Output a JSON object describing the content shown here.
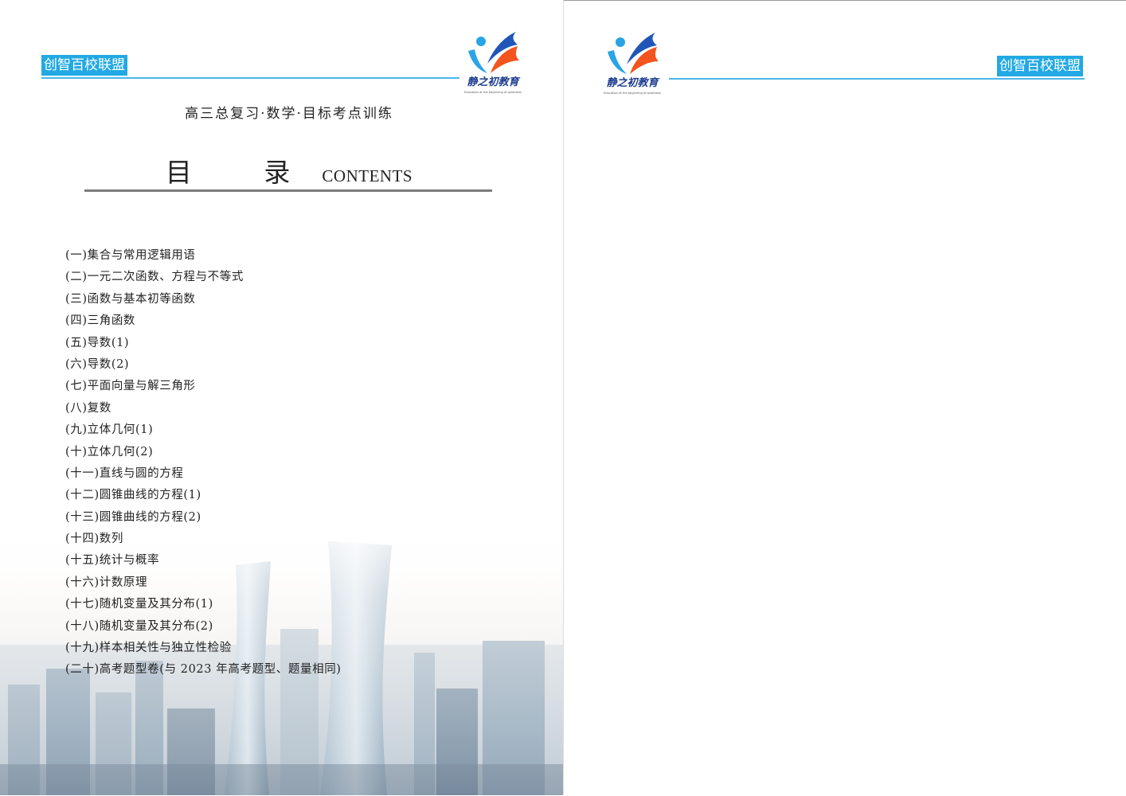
{
  "header": {
    "brand_left": "创智百校联盟",
    "brand_right": "创智百校联盟",
    "logo_text": "静之初教育",
    "logo_tagline": "Education at the beginning of quietness",
    "brand_color": "#22a9e3",
    "logo_colors": [
      "#1f56b8",
      "#f4541e",
      "#29a4e6"
    ]
  },
  "book_title": "高三总复习·数学·目标考点训练",
  "toc": {
    "heading_cn": "目 录",
    "heading_en": "CONTENTS",
    "items": [
      "(一)集合与常用逻辑用语",
      "(二)一元二次函数、方程与不等式",
      "(三)函数与基本初等函数",
      "(四)三角函数",
      "(五)导数(1)",
      "(六)导数(2)",
      "(七)平面向量与解三角形",
      "(八)复数",
      "(九)立体几何(1)",
      "(十)立体几何(2)",
      "(十一)直线与圆的方程",
      "(十二)圆锥曲线的方程(1)",
      "(十三)圆锥曲线的方程(2)",
      "(十四)数列",
      "(十五)统计与概率",
      "(十六)计数原理",
      "(十七)随机变量及其分布(1)",
      "(十八)随机变量及其分布(2)",
      "(十九)样本相关性与独立性检验",
      "(二十)高考题型卷(与 2023 年高考题型、题量相同)"
    ]
  },
  "background": {
    "image": "city-skyline-photo"
  }
}
